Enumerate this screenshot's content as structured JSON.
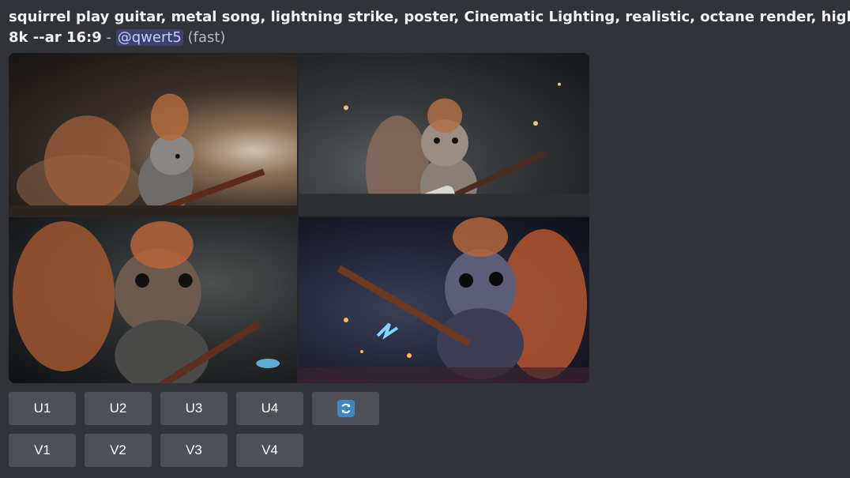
{
  "message": {
    "prompt_line1": "squirrel play guitar, metal song, lightning strike, poster, Cinematic Lighting, realistic, octane render, high detail, full",
    "prompt_line2": "8k --ar 16:9",
    "separator": " - ",
    "mention": "@qwert5",
    "speed": "(fast)"
  },
  "image_grid": {
    "tiles": [
      {
        "subject": "squirrel playing guitar",
        "position": "top-left"
      },
      {
        "subject": "squirrel playing guitar",
        "position": "top-right"
      },
      {
        "subject": "squirrel playing guitar",
        "position": "bottom-left"
      },
      {
        "subject": "squirrel playing guitar",
        "position": "bottom-right"
      }
    ]
  },
  "buttons": {
    "upscale": [
      "U1",
      "U2",
      "U3",
      "U4"
    ],
    "variation": [
      "V1",
      "V2",
      "V3",
      "V4"
    ],
    "reroll_icon": "refresh-icon"
  },
  "colors": {
    "background": "#313338",
    "button": "#4e5058",
    "mention_bg": "rgba(88,101,242,0.3)",
    "refresh_accent": "#3b88c3"
  }
}
